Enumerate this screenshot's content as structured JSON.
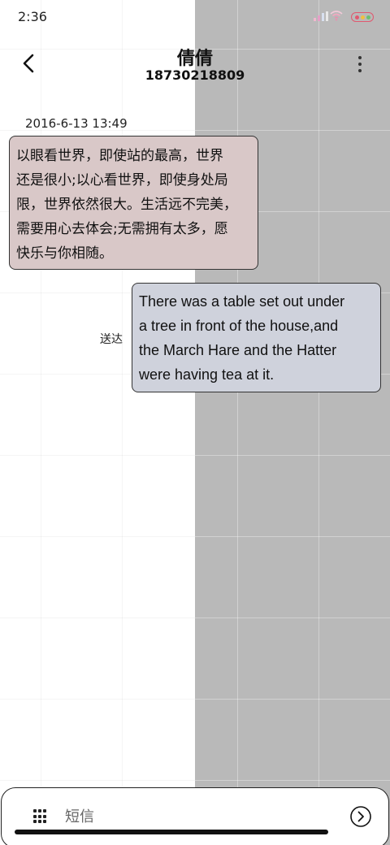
{
  "status_bar": {
    "time": "2:36"
  },
  "header": {
    "contact_name": "倩倩",
    "contact_number": "18730218809"
  },
  "conversation": {
    "timestamp": "2016-6-13 13:49",
    "incoming_lines": [
      "以眼看世界，即使站的最高，世界",
      "还是很小;以心看世界，即使身处局",
      "限，世界依然很大。生活远不完美，",
      "需要用心去体会;无需拥有太多，愿",
      "快乐与你相随。"
    ],
    "outgoing_lines": [
      "There was a table set out under",
      "a tree in front of the house,and",
      "the March Hare and the Hatter",
      "were having tea at it."
    ],
    "outgoing_status": "送达"
  },
  "composer": {
    "placeholder": "短信"
  },
  "colors": {
    "incoming_bubble": "#d9c8c8",
    "outgoing_bubble": "#cfd2dc",
    "right_panel": "#b9b9b9"
  }
}
